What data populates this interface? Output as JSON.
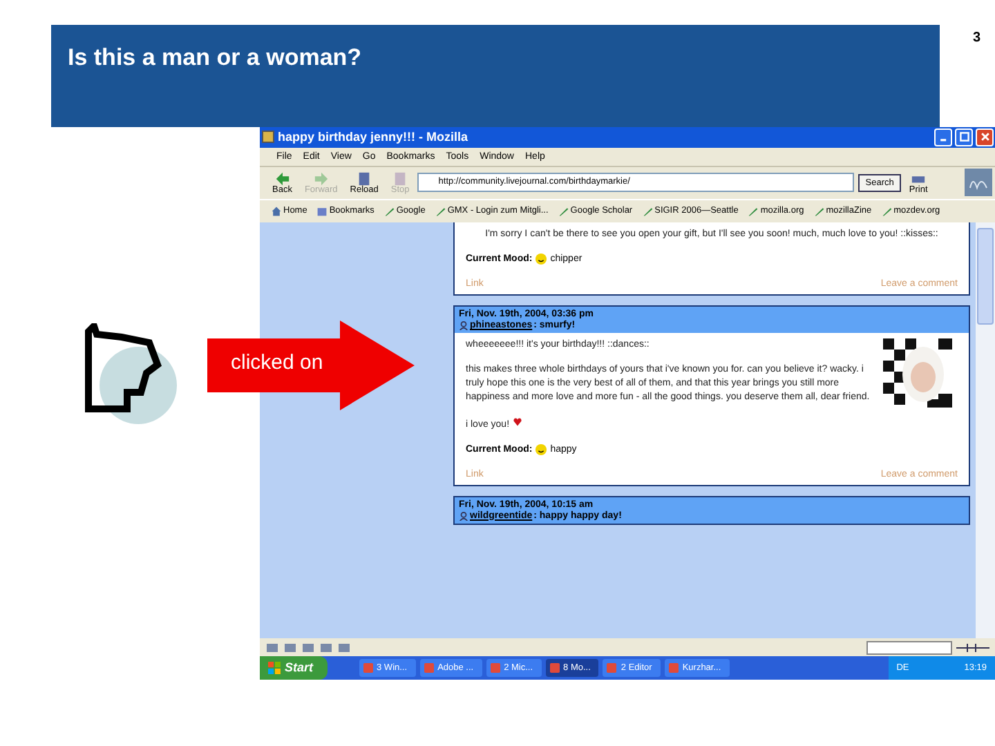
{
  "slide": {
    "title": "Is this a man or a woman?",
    "page_number": "3",
    "callout": "clicked on"
  },
  "browser": {
    "title": "happy birthday jenny!!! - Mozilla",
    "menu": [
      "File",
      "Edit",
      "View",
      "Go",
      "Bookmarks",
      "Tools",
      "Window",
      "Help"
    ],
    "nav_buttons": [
      {
        "label": "Back",
        "kind": "back",
        "disabled": false
      },
      {
        "label": "Forward",
        "kind": "forward",
        "disabled": true
      },
      {
        "label": "Reload",
        "kind": "reload",
        "disabled": false
      },
      {
        "label": "Stop",
        "kind": "stop",
        "disabled": true
      }
    ],
    "address": "http://community.livejournal.com/birthdaymarkie/",
    "search_button": "Search",
    "print_button": "Print",
    "bookmarks": [
      {
        "label": "Home",
        "kind": "home"
      },
      {
        "label": "Bookmarks",
        "kind": "folder"
      },
      {
        "label": "Google",
        "kind": "link"
      },
      {
        "label": "GMX - Login zum Mitgli...",
        "kind": "link"
      },
      {
        "label": "Google Scholar",
        "kind": "link"
      },
      {
        "label": "SIGIR 2006—Seattle",
        "kind": "link"
      },
      {
        "label": "mozilla.org",
        "kind": "link"
      },
      {
        "label": "mozillaZine",
        "kind": "link"
      },
      {
        "label": "mozdev.org",
        "kind": "link"
      }
    ],
    "entries": [
      {
        "kind": "partial",
        "paragraphs": [
          {
            "text": "I'm sorry I can't be there to see you open your gift, but I'll see you soon! much, much love to you! ::kisses::",
            "heart": false
          }
        ],
        "mood_label": "Current Mood:",
        "mood": "chipper",
        "link": "Link",
        "comment_link": "Leave a comment"
      },
      {
        "kind": "full",
        "date": "Fri, Nov. 19th, 2004, 03:36 pm",
        "user": "phineastones",
        "subject": ": smurfy!",
        "has_userpic": true,
        "paragraphs": [
          {
            "text": "wheeeeeee!!! it's your birthday!!! ::dances::",
            "heart": false
          },
          {
            "text": "this makes three whole birthdays of yours that i've known you for. can you believe it? wacky. i truly hope this one is the very best of all of them, and that this year brings you still more happiness and more love and more fun - all the good things. you deserve them all, dear friend.",
            "heart": false
          },
          {
            "text": "i love you!",
            "heart": true
          }
        ],
        "mood_label": "Current Mood:",
        "mood": "happy",
        "link": "Link",
        "comment_link": "Leave a comment"
      },
      {
        "kind": "header",
        "date": "Fri, Nov. 19th, 2004, 10:15 am",
        "user": "wildgreentide",
        "subject": ": happy happy day!"
      }
    ]
  },
  "taskbar": {
    "start": "Start",
    "items": [
      {
        "label": "3 Win...",
        "selected": false
      },
      {
        "label": "Adobe ...",
        "selected": false
      },
      {
        "label": "2 Mic...",
        "selected": false
      },
      {
        "label": "8 Mo...",
        "selected": true
      },
      {
        "label": "2 Editor",
        "selected": false
      },
      {
        "label": "Kurzhar...",
        "selected": false
      }
    ],
    "language": "DE",
    "clock": "13:19"
  }
}
